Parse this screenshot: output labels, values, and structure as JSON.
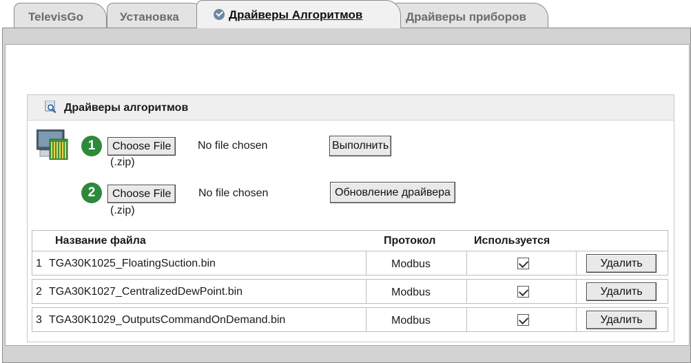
{
  "tabs": [
    {
      "label": "TelevisGo",
      "active": false
    },
    {
      "label": "Установка",
      "active": false
    },
    {
      "label": "Драйверы Алгоритмов",
      "active": true
    },
    {
      "label": "Драйверы приборов",
      "active": false
    }
  ],
  "section": {
    "title": "Драйверы алгоритмов",
    "icon": "magnifier-icon",
    "device_icon": "device-icon"
  },
  "upload_rows": [
    {
      "badge": "1",
      "choose_label": "Choose File",
      "status": "No file chosen",
      "hint": "(.zip)",
      "action_label": "Выполнить"
    },
    {
      "badge": "2",
      "choose_label": "Choose File",
      "status": "No file chosen",
      "hint": "(.zip)",
      "action_label": "Обновление драйвера"
    }
  ],
  "table": {
    "headers": [
      "Название файла",
      "Протокол",
      "Используется"
    ],
    "rows": [
      {
        "index": "1",
        "file": "TGA30K1025_FloatingSuction.bin",
        "protocol": "Modbus",
        "used": true,
        "delete_label": "Удалить"
      },
      {
        "index": "2",
        "file": "TGA30K1027_CentralizedDewPoint.bin",
        "protocol": "Modbus",
        "used": true,
        "delete_label": "Удалить"
      },
      {
        "index": "3",
        "file": "TGA30K1029_OutputsCommandOnDemand.bin",
        "protocol": "Modbus",
        "used": true,
        "delete_label": "Удалить"
      }
    ]
  },
  "colors": {
    "badge": "#2c8a3a",
    "panel": "#d3d3d3",
    "tab_inactive": "#e3e3e3"
  }
}
